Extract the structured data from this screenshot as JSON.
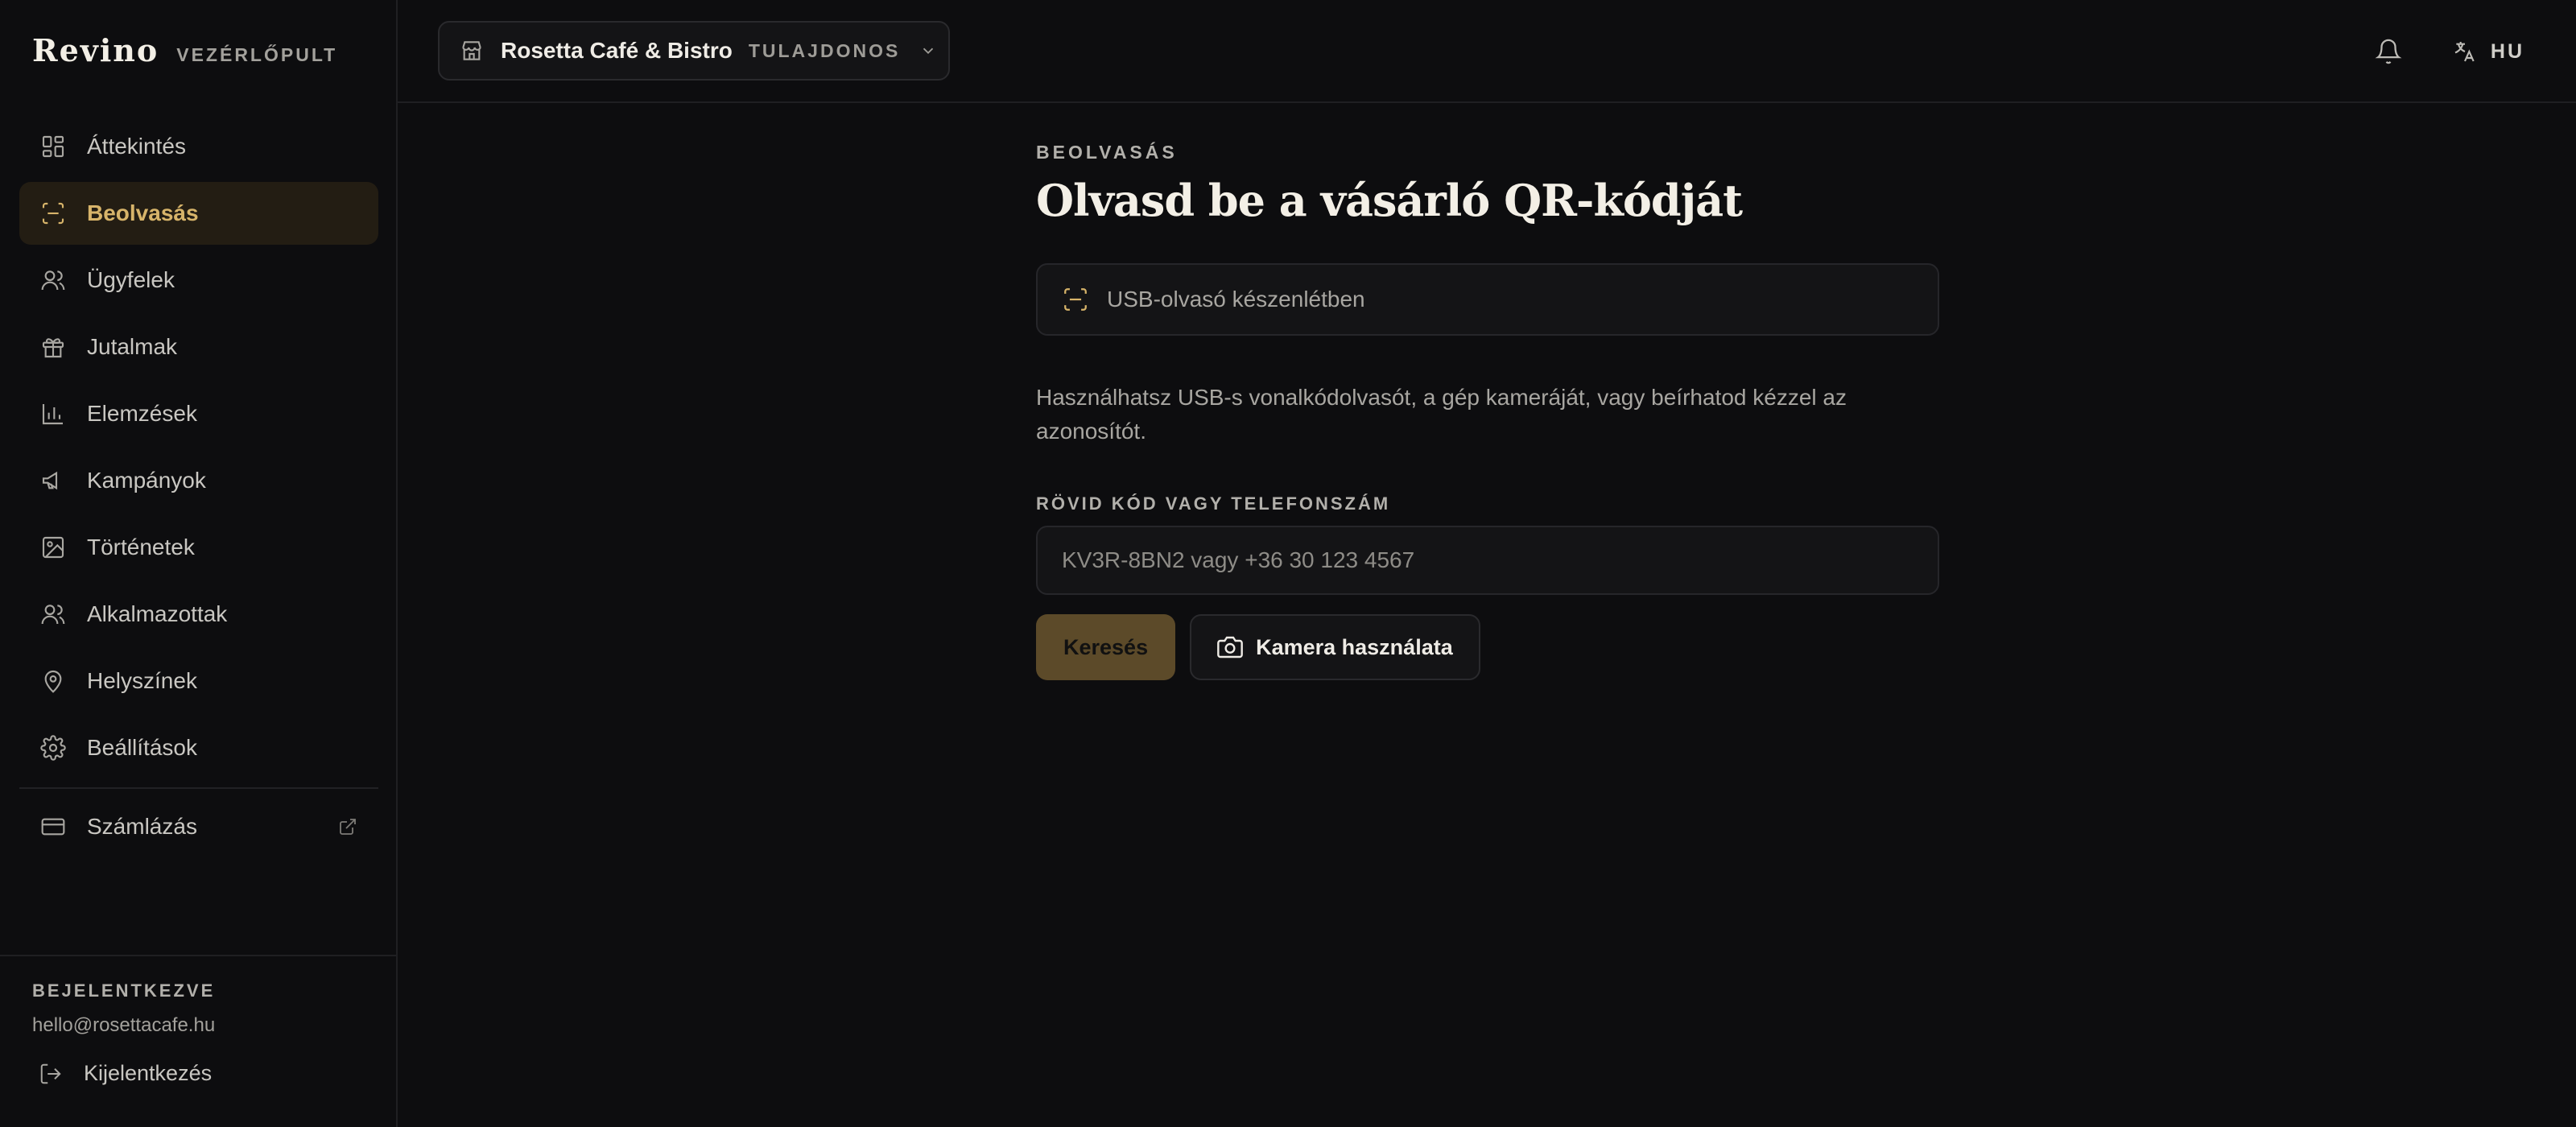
{
  "brand": {
    "name": "Revino",
    "subtitle": "VEZÉRLŐPULT"
  },
  "sidebar": {
    "items": [
      {
        "label": "Áttekintés",
        "icon": "dashboard-icon",
        "active": false
      },
      {
        "label": "Beolvasás",
        "icon": "scan-icon",
        "active": true
      },
      {
        "label": "Ügyfelek",
        "icon": "users-icon",
        "active": false
      },
      {
        "label": "Jutalmak",
        "icon": "gift-icon",
        "active": false
      },
      {
        "label": "Elemzések",
        "icon": "bar-chart-icon",
        "active": false
      },
      {
        "label": "Kampányok",
        "icon": "megaphone-icon",
        "active": false
      },
      {
        "label": "Történetek",
        "icon": "image-icon",
        "active": false
      },
      {
        "label": "Alkalmazottak",
        "icon": "staff-icon",
        "active": false
      },
      {
        "label": "Helyszínek",
        "icon": "map-pin-icon",
        "active": false
      },
      {
        "label": "Beállítások",
        "icon": "gear-icon",
        "active": false
      }
    ],
    "billing": {
      "label": "Számlázás",
      "icon": "credit-card-icon",
      "external_icon": "external-link-icon"
    },
    "footer": {
      "label": "BEJELENTKEZVE",
      "email": "hello@rosettacafe.hu",
      "logout": "Kijelentkezés"
    }
  },
  "topbar": {
    "venue_name": "Rosetta Café & Bistro",
    "venue_role": "TULAJDONOS",
    "language": "HU"
  },
  "main": {
    "eyebrow": "BEOLVASÁS",
    "title": "Olvasd be a vásárló QR-kódját",
    "scanner_status": "USB-olvasó készenlétben",
    "help": "Használhatsz USB-s vonalkódolvasót, a gép kameráját, vagy beírhatod kézzel az azonosítót.",
    "field_label": "RÖVID KÓD VAGY TELEFONSZÁM",
    "field_value": "",
    "field_placeholder": "KV3R-8BN2 vagy +36 30 123 4567",
    "search_button": "Keresés",
    "camera_button": "Kamera használata"
  },
  "colors": {
    "accent": "#d7b46a",
    "background": "#0d0d0f",
    "primary_button": "#5c4a29"
  }
}
